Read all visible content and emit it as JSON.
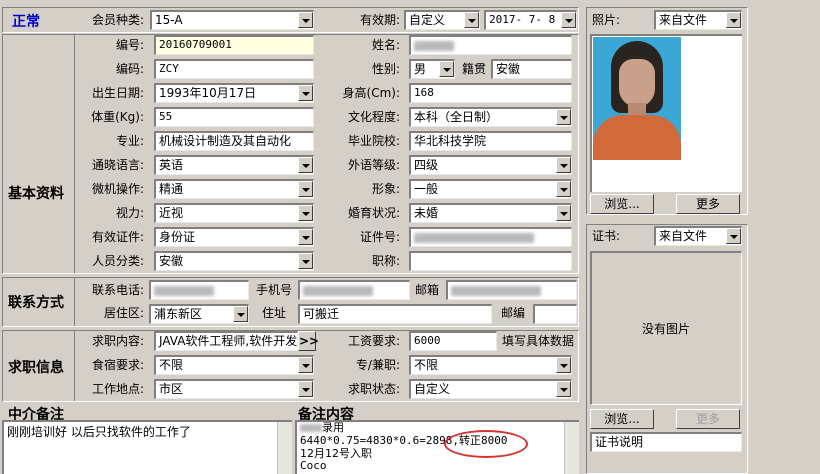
{
  "header": {
    "title": "正常",
    "member_type_label": "会员种类:",
    "member_type_value": "15-A",
    "validity_label": "有效期:",
    "validity_value": "自定义",
    "validity_date": "2017- 7- 8"
  },
  "basic": {
    "section_title": "基本资料",
    "id_label": "编号:",
    "id_value": "20160709001",
    "name_label": "姓名:",
    "code_label": "编码:",
    "code_value": "ZCY",
    "gender_label": "性别:",
    "gender_value": "男",
    "native_label": "籍贯",
    "native_value": "安徽",
    "birth_label": "出生日期:",
    "birth_value": "1993年10月17日",
    "height_label": "身高(Cm):",
    "height_value": "168",
    "weight_label": "体重(Kg):",
    "weight_value": "55",
    "education_label": "文化程度:",
    "education_value": "本科（全日制）",
    "major_label": "专业:",
    "major_value": "机械设计制造及其自动化",
    "school_label": "毕业院校:",
    "school_value": "华北科技学院",
    "language_label": "通晓语言:",
    "language_value": "英语",
    "foreign_level_label": "外语等级:",
    "foreign_level_value": "四级",
    "computer_label": "微机操作:",
    "computer_value": "精通",
    "image_label": "形象:",
    "image_value": "一般",
    "vision_label": "视力:",
    "vision_value": "近视",
    "marital_label": "婚育状况:",
    "marital_value": "未婚",
    "cert_label": "有效证件:",
    "cert_value": "身份证",
    "cert_no_label": "证件号:",
    "category_label": "人员分类:",
    "category_value": "安徽",
    "title_label": "职称:"
  },
  "contact": {
    "section_title": "联系方式",
    "phone_label": "联系电话:",
    "mobile_label": "手机号",
    "email_label": "邮箱",
    "district_label": "居住区:",
    "district_value": "浦东新区",
    "address_label": "住址",
    "address_value": "可搬迁",
    "postcode_label": "邮编"
  },
  "job": {
    "section_title": "求职信息",
    "content_label": "求职内容:",
    "content_value": "JAVA软件工程师,软件开发",
    "more_button": ">>",
    "salary_label": "工资要求:",
    "salary_value": "6000",
    "salary_note": "填写具体数据",
    "meals_label": "食宿要求:",
    "meals_value": "不限",
    "parttime_label": "专/兼职:",
    "parttime_value": "不限",
    "location_label": "工作地点:",
    "location_value": "市区",
    "status_label": "求职状态:",
    "status_value": "自定义"
  },
  "notes": {
    "agency_title": "中介备注",
    "agency_text": "刚刚培训好 以后只找软件的工作了",
    "remarks_title": "备注内容",
    "remark_line1": "录用",
    "remark_line2": "6440*0.75=4830*0.6=2898,",
    "remark_highlight": "转正8000",
    "remark_line3": "12月12号入职",
    "remark_line4": "Coco"
  },
  "photo_panel": {
    "label": "照片:",
    "source_value": "来自文件",
    "browse_button": "浏览...",
    "more_button": "更多"
  },
  "cert_panel": {
    "label": "证书:",
    "source_value": "来自文件",
    "empty_text": "没有图片",
    "browse_button": "浏览...",
    "more_button": "更多",
    "description_value": "证书说明"
  },
  "colors": {
    "title_blue": "#0000cc",
    "highlight_circle": "#d93030",
    "window_bg": "#d4d0c8"
  }
}
